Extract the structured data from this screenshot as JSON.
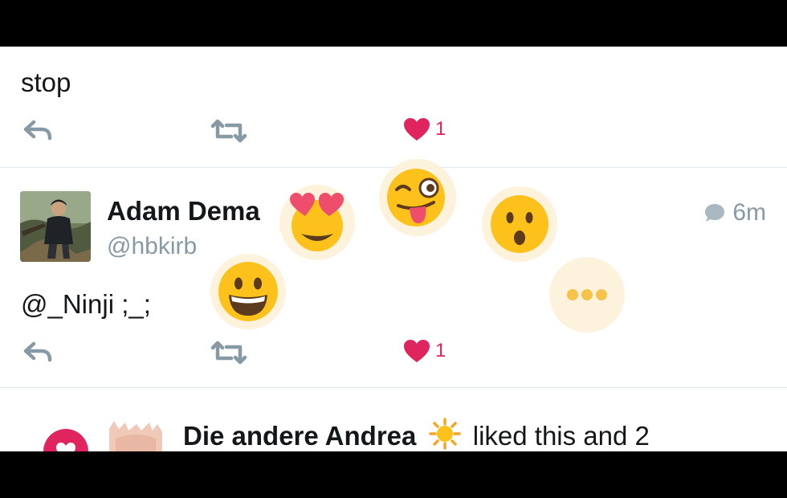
{
  "tweet1": {
    "text": "stop",
    "like_count": "1"
  },
  "tweet2": {
    "author_name": "Adam Dema",
    "handle": "@hbkirb",
    "time": "6m",
    "text": "@_Ninji ;_;",
    "like_count": "1"
  },
  "reactions": [
    {
      "icon": "heart-eyes-emoji"
    },
    {
      "icon": "winking-tongue-emoji"
    },
    {
      "icon": "surprised-emoji"
    },
    {
      "icon": "grinning-emoji"
    },
    {
      "icon": "more-ellipsis-icon"
    }
  ],
  "notification": {
    "name": "Die andere Andrea",
    "suffix": "liked this and 2"
  },
  "colors": {
    "like": "#e0245e",
    "icon_gray": "#8899a6",
    "divider": "#e1e8ed",
    "emoji_yellow": "#fcc21b"
  }
}
